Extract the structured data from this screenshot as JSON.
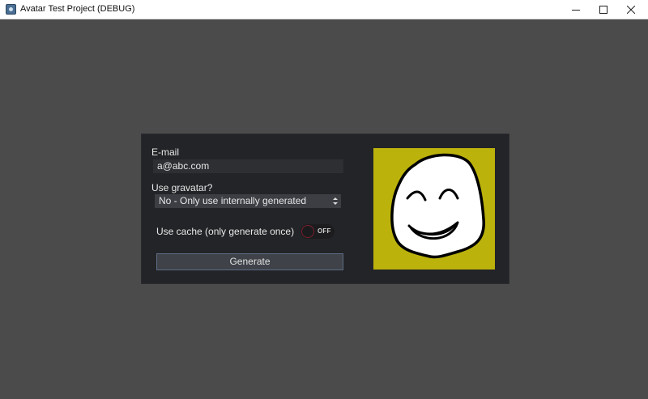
{
  "window": {
    "title": "Avatar Test Project (DEBUG)"
  },
  "form": {
    "email_label": "E-mail",
    "email_value": "a@abc.com",
    "gravatar_label": "Use gravatar?",
    "gravatar_selected": "No - Only use internally generated",
    "cache_label": "Use cache (only generate once)",
    "cache_toggle_text": "OFF",
    "cache_enabled": false,
    "generate_label": "Generate"
  },
  "avatar": {
    "icon": "smiley-face-icon",
    "background_color": "#bcb20c"
  },
  "colors": {
    "window_background": "#4b4b4b",
    "panel_background": "#232427",
    "button_border": "#5d6c84",
    "toggle_knob_border": "#7a1f2c"
  }
}
